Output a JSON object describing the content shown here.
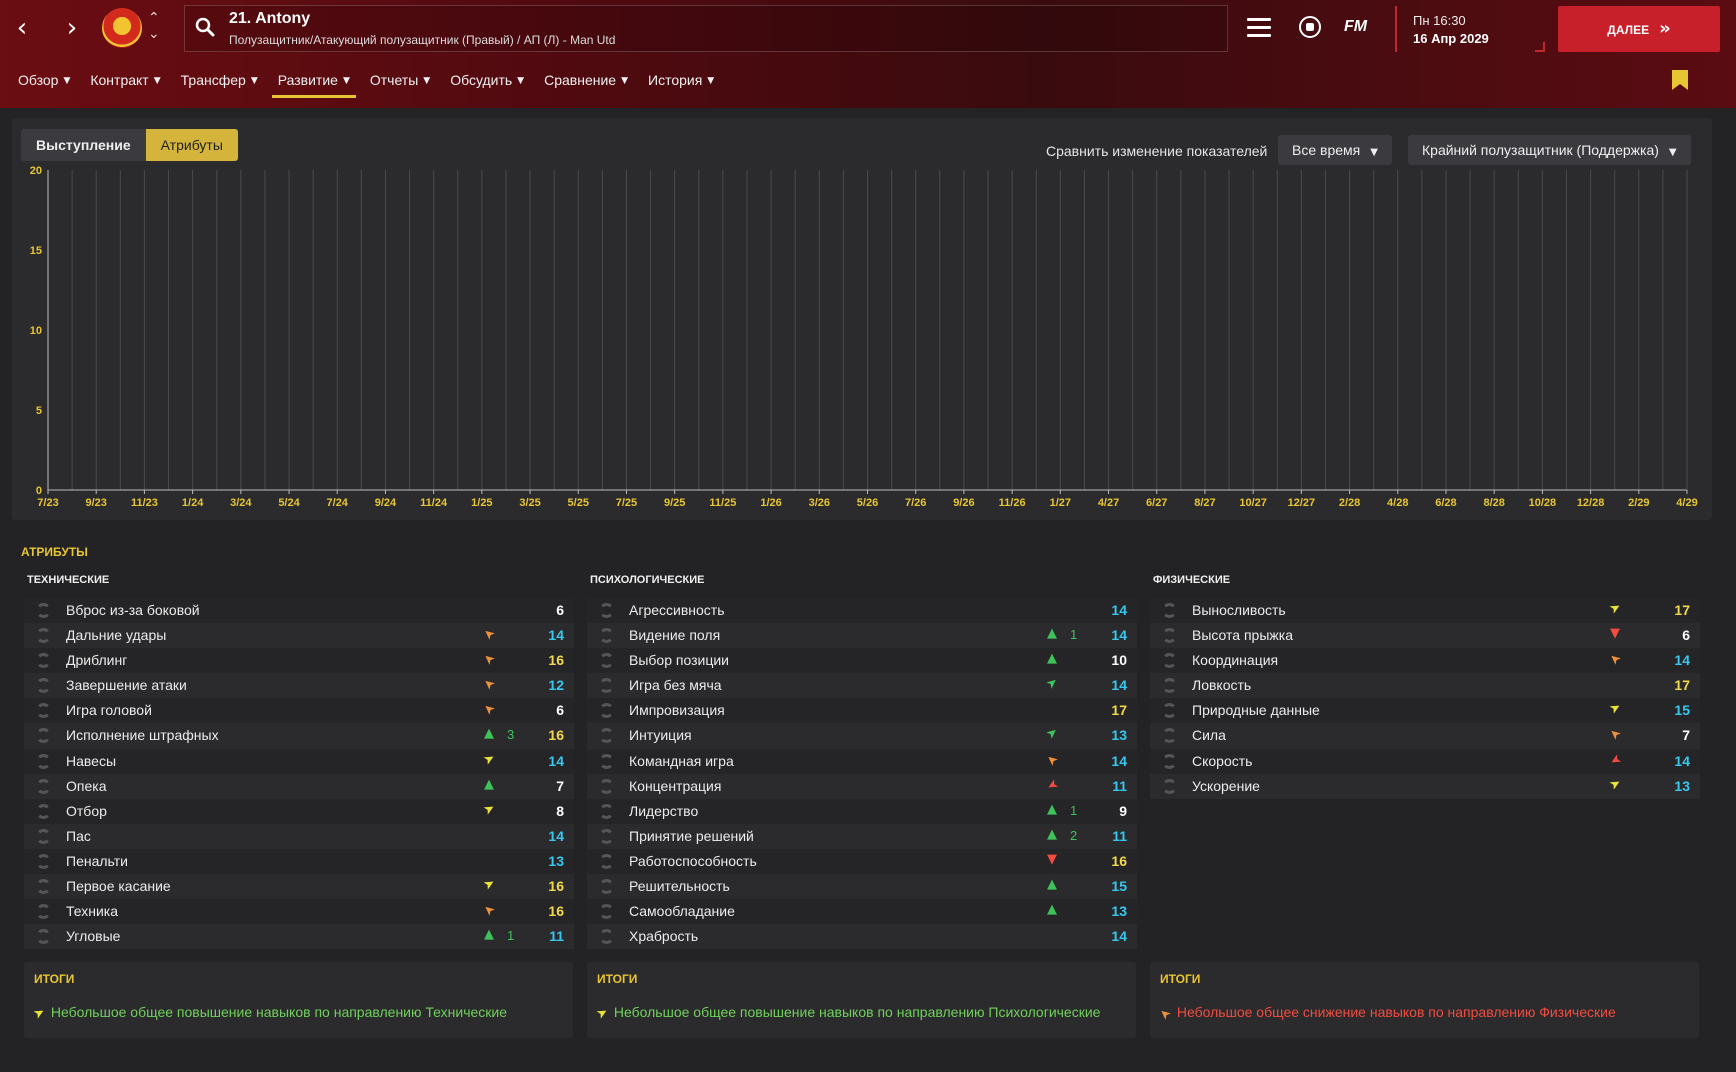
{
  "header": {
    "player_name": "21. Antony",
    "player_subtitle": "Полузащитник/Атакующий полузащитник (Правый) / АП (Л) - Man Utd",
    "date_day": "Пн 16:30",
    "date_full": "16 Апр 2029",
    "continue_label": "ДАЛЕЕ",
    "fm_logo": "FM"
  },
  "tabs": [
    {
      "label": "Обзор"
    },
    {
      "label": "Контракт"
    },
    {
      "label": "Трансфер"
    },
    {
      "label": "Развитие"
    },
    {
      "label": "Отчеты"
    },
    {
      "label": "Обсудить"
    },
    {
      "label": "Сравнение"
    },
    {
      "label": "История"
    }
  ],
  "active_tab": "Развитие",
  "panel": {
    "seg_performance": "Выступление",
    "seg_attributes": "Атрибуты",
    "compare_label": "Сравнить изменение показателей",
    "period_dropdown": "Все время",
    "role_dropdown": "Крайний полузащитник (Поддержка)"
  },
  "chart_data": {
    "type": "line",
    "ylim": [
      0,
      20
    ],
    "y_ticks": [
      "0",
      "5",
      "10",
      "15",
      "20"
    ],
    "x_tick_labels": [
      "7/23",
      "9/23",
      "11/23",
      "1/24",
      "3/24",
      "5/24",
      "7/24",
      "9/24",
      "11/24",
      "1/25",
      "3/25",
      "5/25",
      "7/25",
      "9/25",
      "11/25",
      "1/26",
      "3/26",
      "5/26",
      "7/26",
      "9/26",
      "11/26",
      "1/27",
      "4/27",
      "6/27",
      "8/27",
      "10/27",
      "12/27",
      "2/28",
      "4/28",
      "6/28",
      "8/28",
      "10/28",
      "12/28",
      "2/29",
      "4/29"
    ],
    "series": [],
    "grid": true,
    "colors": {
      "axis_label": "#e8c532",
      "grid": "#4a4a4e"
    }
  },
  "attributes_heading": "АТРИБУТЫ",
  "columns": [
    {
      "title": "ТЕХНИЧЕСКИЕ",
      "items": [
        {
          "name": "Вброс из-за боковой",
          "trend": "",
          "delta": "",
          "value": "6",
          "value_color": "#ffffff"
        },
        {
          "name": "Дальние удары",
          "trend": "down-slight",
          "delta": "",
          "value": "14",
          "value_color": "#36c8ef"
        },
        {
          "name": "Дриблинг",
          "trend": "down-slight",
          "delta": "",
          "value": "16",
          "value_color": "#f2d94a"
        },
        {
          "name": "Завершение атаки",
          "trend": "down-slight",
          "delta": "",
          "value": "12",
          "value_color": "#36c8ef"
        },
        {
          "name": "Игра головой",
          "trend": "down-slight",
          "delta": "",
          "value": "6",
          "value_color": "#ffffff"
        },
        {
          "name": "Исполнение штрафных",
          "trend": "up",
          "delta": "3",
          "value": "16",
          "value_color": "#f2d94a"
        },
        {
          "name": "Навесы",
          "trend": "up-slight",
          "delta": "",
          "value": "14",
          "value_color": "#36c8ef"
        },
        {
          "name": "Опека",
          "trend": "up",
          "delta": "",
          "value": "7",
          "value_color": "#ffffff"
        },
        {
          "name": "Отбор",
          "trend": "up-slight",
          "delta": "",
          "value": "8",
          "value_color": "#ffffff"
        },
        {
          "name": "Пас",
          "trend": "",
          "delta": "",
          "value": "14",
          "value_color": "#36c8ef"
        },
        {
          "name": "Пенальти",
          "trend": "",
          "delta": "",
          "value": "13",
          "value_color": "#36c8ef"
        },
        {
          "name": "Первое касание",
          "trend": "up-slight",
          "delta": "",
          "value": "16",
          "value_color": "#f2d94a"
        },
        {
          "name": "Техника",
          "trend": "down-slight",
          "delta": "",
          "value": "16",
          "value_color": "#f2d94a"
        },
        {
          "name": "Угловые",
          "trend": "up",
          "delta": "1",
          "value": "11",
          "value_color": "#36c8ef"
        }
      ]
    },
    {
      "title": "ПСИХОЛОГИЧЕСКИЕ",
      "items": [
        {
          "name": "Агрессивность",
          "trend": "",
          "delta": "",
          "value": "14",
          "value_color": "#36c8ef"
        },
        {
          "name": "Видение поля",
          "trend": "up",
          "delta": "1",
          "value": "14",
          "value_color": "#36c8ef"
        },
        {
          "name": "Выбор позиции",
          "trend": "up",
          "delta": "",
          "value": "10",
          "value_color": "#ffffff"
        },
        {
          "name": "Игра без мяча",
          "trend": "up-green",
          "delta": "",
          "value": "14",
          "value_color": "#36c8ef"
        },
        {
          "name": "Импровизация",
          "trend": "",
          "delta": "",
          "value": "17",
          "value_color": "#f2d94a"
        },
        {
          "name": "Интуиция",
          "trend": "up-green",
          "delta": "",
          "value": "13",
          "value_color": "#36c8ef"
        },
        {
          "name": "Командная игра",
          "trend": "down-slight",
          "delta": "",
          "value": "14",
          "value_color": "#36c8ef"
        },
        {
          "name": "Концентрация",
          "trend": "down-red",
          "delta": "",
          "value": "11",
          "value_color": "#36c8ef"
        },
        {
          "name": "Лидерство",
          "trend": "up",
          "delta": "1",
          "value": "9",
          "value_color": "#ffffff"
        },
        {
          "name": "Принятие решений",
          "trend": "up",
          "delta": "2",
          "value": "11",
          "value_color": "#36c8ef"
        },
        {
          "name": "Работоспособность",
          "trend": "down",
          "delta": "",
          "value": "16",
          "value_color": "#f2d94a"
        },
        {
          "name": "Решительность",
          "trend": "up",
          "delta": "",
          "value": "15",
          "value_color": "#36c8ef"
        },
        {
          "name": "Самообладание",
          "trend": "up",
          "delta": "",
          "value": "13",
          "value_color": "#36c8ef"
        },
        {
          "name": "Храбрость",
          "trend": "",
          "delta": "",
          "value": "14",
          "value_color": "#36c8ef"
        }
      ]
    },
    {
      "title": "ФИЗИЧЕСКИЕ",
      "items": [
        {
          "name": "Выносливость",
          "trend": "up-slight",
          "delta": "",
          "value": "17",
          "value_color": "#f2d94a"
        },
        {
          "name": "Высота прыжка",
          "trend": "down",
          "delta": "",
          "value": "6",
          "value_color": "#ffffff"
        },
        {
          "name": "Координация",
          "trend": "down-slight",
          "delta": "",
          "value": "14",
          "value_color": "#36c8ef"
        },
        {
          "name": "Ловкость",
          "trend": "",
          "delta": "",
          "value": "17",
          "value_color": "#f2d94a"
        },
        {
          "name": "Природные данные",
          "trend": "up-slight",
          "delta": "",
          "value": "15",
          "value_color": "#36c8ef"
        },
        {
          "name": "Сила",
          "trend": "down-slight",
          "delta": "",
          "value": "7",
          "value_color": "#ffffff"
        },
        {
          "name": "Скорость",
          "trend": "down-red",
          "delta": "",
          "value": "14",
          "value_color": "#36c8ef"
        },
        {
          "name": "Ускорение",
          "trend": "up-slight",
          "delta": "",
          "value": "13",
          "value_color": "#36c8ef"
        }
      ]
    }
  ],
  "summaries": [
    {
      "title": "ИТОГИ",
      "text": "Небольшое общее повышение навыков по направлению Технические",
      "kind": "pos"
    },
    {
      "title": "ИТОГИ",
      "text": "Небольшое общее повышение навыков по направлению Психологические",
      "kind": "pos"
    },
    {
      "title": "ИТОГИ",
      "text": "Небольшое общее снижение навыков по направлению Физические",
      "kind": "neg"
    }
  ]
}
